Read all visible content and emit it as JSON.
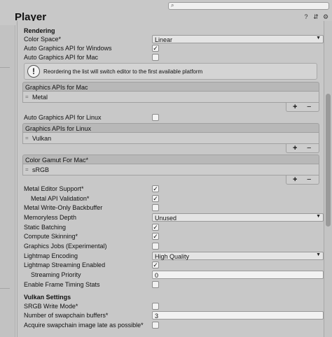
{
  "window": {
    "title": "Player"
  },
  "header_icons": [
    "help-icon",
    "preset-icon",
    "gear-icon"
  ],
  "rendering": {
    "section_title": "Rendering",
    "color_space_label": "Color Space*",
    "color_space_value": "Linear",
    "auto_api_windows_label": "Auto Graphics API  for Windows",
    "auto_api_windows_checked": true,
    "auto_api_mac_label": "Auto Graphics API  for Mac",
    "auto_api_mac_checked": false,
    "info_message": "Reordering the list will switch editor to the first available platform",
    "info_badge": "!",
    "graphics_apis_mac_header": "Graphics APIs for Mac",
    "graphics_apis_mac_items": [
      "Metal"
    ],
    "auto_api_linux_label": "Auto Graphics API  for Linux",
    "auto_api_linux_checked": false,
    "graphics_apis_linux_header": "Graphics APIs for Linux",
    "graphics_apis_linux_items": [
      "Vulkan"
    ],
    "color_gamut_mac_header": "Color Gamut For Mac*",
    "color_gamut_mac_items": [
      "sRGB"
    ],
    "list_add": "+",
    "list_remove": "−",
    "list_handle": "=",
    "metal_editor_support_label": "Metal Editor Support*",
    "metal_editor_support_checked": true,
    "metal_api_validation_label": "Metal API Validation*",
    "metal_api_validation_checked": true,
    "metal_write_only_label": "Metal Write-Only Backbuffer",
    "metal_write_only_checked": false,
    "memoryless_depth_label": "Memoryless Depth",
    "memoryless_depth_value": "Unused",
    "static_batching_label": "Static Batching",
    "static_batching_checked": true,
    "compute_skinning_label": "Compute Skinning*",
    "compute_skinning_checked": true,
    "graphics_jobs_label": "Graphics Jobs (Experimental)",
    "graphics_jobs_checked": false,
    "lightmap_encoding_label": "Lightmap Encoding",
    "lightmap_encoding_value": "High Quality",
    "lightmap_streaming_label": "Lightmap Streaming Enabled",
    "lightmap_streaming_checked": true,
    "streaming_priority_label": "Streaming Priority",
    "streaming_priority_value": "0",
    "frame_timing_label": "Enable Frame Timing Stats",
    "frame_timing_checked": false
  },
  "vulkan": {
    "section_title": "Vulkan Settings",
    "srgb_write_label": "SRGB Write Mode*",
    "srgb_write_checked": false,
    "swapchain_buffers_label": "Number of swapchain buffers*",
    "swapchain_buffers_value": "3",
    "acquire_late_label": "Acquire swapchain image late as possible*",
    "acquire_late_checked": false
  },
  "glyphs": {
    "check": "✓",
    "dropdown_arrow": "▼",
    "search": "⌕"
  }
}
